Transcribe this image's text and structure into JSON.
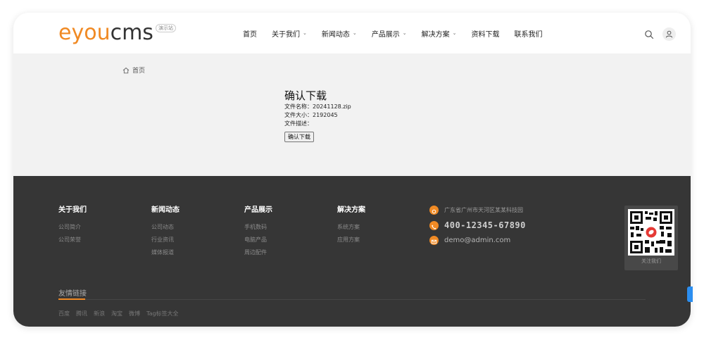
{
  "header": {
    "logo_main": "eyou",
    "logo_sub": "cms",
    "logo_badge": "演示站",
    "nav": [
      {
        "label": "首页",
        "dropdown": false
      },
      {
        "label": "关于我们",
        "dropdown": true
      },
      {
        "label": "新闻动态",
        "dropdown": true
      },
      {
        "label": "产品展示",
        "dropdown": true
      },
      {
        "label": "解决方案",
        "dropdown": true
      },
      {
        "label": "资料下载",
        "dropdown": false
      },
      {
        "label": "联系我们",
        "dropdown": false
      }
    ]
  },
  "breadcrumb": {
    "home": "首页"
  },
  "download": {
    "title": "确认下载",
    "name_line": "文件名称：20241128.zip",
    "size_line": "文件大小：2192045",
    "desc_line": "文件描述：",
    "button": "确认下载"
  },
  "footer": {
    "columns": [
      {
        "title": "关于我们",
        "links": [
          "公司简介",
          "公司荣誉"
        ]
      },
      {
        "title": "新闻动态",
        "links": [
          "公司动态",
          "行业资讯",
          "媒体报道"
        ]
      },
      {
        "title": "产品展示",
        "links": [
          "手机数码",
          "电脑产品",
          "周边配件"
        ]
      },
      {
        "title": "解决方案",
        "links": [
          "系统方案",
          "应用方案"
        ]
      }
    ],
    "contact": {
      "address": "广东省广州市天河区某某科技园",
      "phone": "400-12345-67890",
      "email": "demo@admin.com"
    },
    "qr_label": "关注我们",
    "links_title": "友情链接",
    "friend_links": [
      "百度",
      "腾讯",
      "新浪",
      "淘宝",
      "微博",
      "Tag标签大全"
    ]
  },
  "colors": {
    "accent": "#f08a24",
    "footer_bg": "#363636",
    "page_bg": "#f2f2f2"
  }
}
